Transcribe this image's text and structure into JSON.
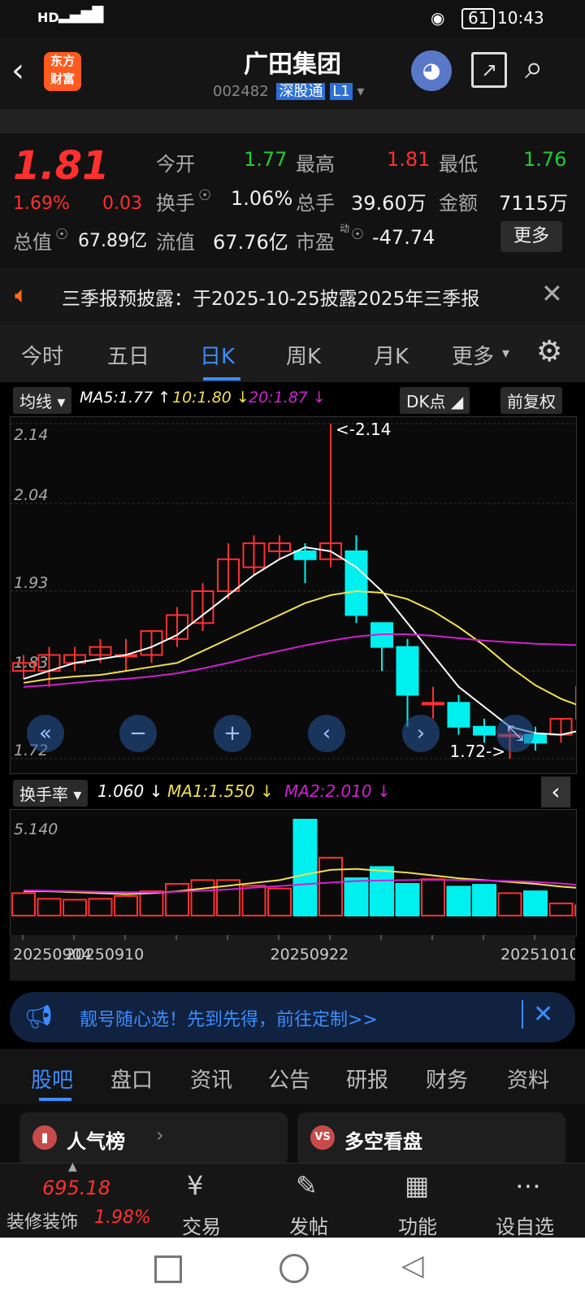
{
  "status_bar": {
    "network": "HD",
    "signal": "5G",
    "battery": "61",
    "time": "10:43"
  },
  "header": {
    "logo_line1": "东方",
    "logo_line2": "财富",
    "title": "广田集团",
    "code": "002482",
    "tag1": "深股通",
    "tag2": "L1"
  },
  "quote": {
    "price": "1.81",
    "change_pct": "1.69%",
    "change": "0.03",
    "open_label": "今开",
    "open": "1.77",
    "high_label": "最高",
    "high": "1.81",
    "low_label": "最低",
    "low": "1.76",
    "turnover_label": "换手",
    "turnover": "1.06%",
    "volume_label": "总手",
    "volume": "39.60万",
    "amount_label": "金额",
    "amount": "7115万",
    "mktcap_label": "总值",
    "mktcap": "67.89亿",
    "float_label": "流值",
    "float": "67.76亿",
    "pe_label": "市盈",
    "pe_sup": "动",
    "pe": "-47.74",
    "more_label": "更多"
  },
  "notice": {
    "text": "三季报预披露：于2025-10-25披露2025年三季报"
  },
  "tabs": [
    "今时",
    "五日",
    "日K",
    "周K",
    "月K",
    "更多"
  ],
  "active_tab": 2,
  "chart_controls": {
    "indicator": "均线",
    "ma5": "MA5:1.77",
    "ma10": "10:1.80",
    "ma20": "20:1.87",
    "dk": "DK点",
    "fq": "前复权"
  },
  "volume_controls": {
    "indicator": "换手率",
    "val": "1.060",
    "ma1": "MA1:1.550",
    "ma2": "MA2:2.010"
  },
  "colors": {
    "up": "#ff3030",
    "down": "#00f0f0",
    "ma5": "#ffffff",
    "ma10": "#f0e050",
    "ma20": "#d020d0"
  },
  "chart_data": {
    "type": "candlestick",
    "y_ticks": [
      "2.14",
      "2.04",
      "1.93",
      "1.83",
      "1.72"
    ],
    "ylim": [
      1.72,
      2.14
    ],
    "max_label": "<-2.14",
    "min_label": "1.72->",
    "candles": [
      {
        "o": 1.83,
        "c": 1.84,
        "h": 1.85,
        "l": 1.82
      },
      {
        "o": 1.83,
        "c": 1.85,
        "h": 1.86,
        "l": 1.81
      },
      {
        "o": 1.84,
        "c": 1.85,
        "h": 1.86,
        "l": 1.83
      },
      {
        "o": 1.85,
        "c": 1.86,
        "h": 1.87,
        "l": 1.84
      },
      {
        "o": 1.85,
        "c": 1.85,
        "h": 1.87,
        "l": 1.83
      },
      {
        "o": 1.85,
        "c": 1.88,
        "h": 1.88,
        "l": 1.84
      },
      {
        "o": 1.87,
        "c": 1.9,
        "h": 1.91,
        "l": 1.86
      },
      {
        "o": 1.89,
        "c": 1.93,
        "h": 1.94,
        "l": 1.88
      },
      {
        "o": 1.93,
        "c": 1.97,
        "h": 1.99,
        "l": 1.92
      },
      {
        "o": 1.96,
        "c": 1.99,
        "h": 2.0,
        "l": 1.95
      },
      {
        "o": 1.98,
        "c": 1.99,
        "h": 2.0,
        "l": 1.97
      },
      {
        "o": 1.98,
        "c": 1.97,
        "h": 1.99,
        "l": 1.94
      },
      {
        "o": 1.97,
        "c": 1.99,
        "h": 2.14,
        "l": 1.96
      },
      {
        "o": 1.98,
        "c": 1.9,
        "h": 2.0,
        "l": 1.89
      },
      {
        "o": 1.89,
        "c": 1.86,
        "h": 1.89,
        "l": 1.83
      },
      {
        "o": 1.86,
        "c": 1.8,
        "h": 1.87,
        "l": 1.76
      },
      {
        "o": 1.79,
        "c": 1.79,
        "h": 1.81,
        "l": 1.77
      },
      {
        "o": 1.79,
        "c": 1.76,
        "h": 1.8,
        "l": 1.75
      },
      {
        "o": 1.76,
        "c": 1.75,
        "h": 1.77,
        "l": 1.74
      },
      {
        "o": 1.75,
        "c": 1.75,
        "h": 1.76,
        "l": 1.72
      },
      {
        "o": 1.75,
        "c": 1.74,
        "h": 1.76,
        "l": 1.73
      },
      {
        "o": 1.75,
        "c": 1.77,
        "h": 1.77,
        "l": 1.74
      },
      {
        "o": 1.77,
        "c": 1.81,
        "h": 1.81,
        "l": 1.76
      }
    ],
    "ma5": [
      1.82,
      1.83,
      1.84,
      1.845,
      1.85,
      1.86,
      1.875,
      1.9,
      1.925,
      1.95,
      1.97,
      1.985,
      1.98,
      1.96,
      1.93,
      1.89,
      1.85,
      1.81,
      1.785,
      1.76,
      1.752,
      1.75,
      1.757
    ],
    "ma10": [
      1.815,
      1.82,
      1.823,
      1.825,
      1.83,
      1.835,
      1.84,
      1.855,
      1.87,
      1.885,
      1.9,
      1.915,
      1.925,
      1.93,
      1.928,
      1.92,
      1.905,
      1.885,
      1.862,
      1.835,
      1.812,
      1.795,
      1.783
    ],
    "ma20": [
      1.81,
      1.812,
      1.815,
      1.818,
      1.82,
      1.823,
      1.827,
      1.833,
      1.84,
      1.848,
      1.855,
      1.862,
      1.868,
      1.873,
      1.876,
      1.876,
      1.874,
      1.871,
      1.868,
      1.866,
      1.864,
      1.863,
      1.862
    ],
    "volume": {
      "y_tick": "5.140",
      "ylim": [
        0,
        5.4
      ],
      "values": [
        1.2,
        0.9,
        0.85,
        0.9,
        1.05,
        1.3,
        1.7,
        1.9,
        1.9,
        1.6,
        1.45,
        5.14,
        3.1,
        2.0,
        2.6,
        1.7,
        1.95,
        1.55,
        1.65,
        1.2,
        1.3,
        0.65,
        0.55
      ],
      "ma1": [
        1.3,
        1.3,
        1.25,
        1.2,
        1.15,
        1.2,
        1.3,
        1.45,
        1.6,
        1.75,
        1.9,
        2.2,
        2.45,
        2.5,
        2.4,
        2.3,
        2.15,
        2.0,
        1.9,
        1.8,
        1.7,
        1.55,
        1.45
      ],
      "ma2": [
        1.35,
        1.33,
        1.3,
        1.27,
        1.25,
        1.25,
        1.28,
        1.33,
        1.4,
        1.5,
        1.58,
        1.68,
        1.77,
        1.85,
        1.88,
        1.9,
        1.92,
        1.9,
        1.88,
        1.85,
        1.8,
        1.72,
        1.6
      ]
    },
    "dates": [
      "20250904",
      "20250910",
      "20250922",
      "20251010"
    ]
  },
  "ad_banner": {
    "text": "靓号随心选！先到先得，前往定制>>"
  },
  "sub_tabs": [
    "股吧",
    "盘口",
    "资讯",
    "公告",
    "研报",
    "财务",
    "资料"
  ],
  "cards": {
    "left": "人气榜",
    "left_badge": "VS",
    "right": "多空看盘"
  },
  "bottom_nav": {
    "index_value": "695.18",
    "index_name": "装修装饰",
    "index_change": "1.98%",
    "trade": "交易",
    "post": "发帖",
    "func": "功能",
    "watch": "设自选"
  }
}
